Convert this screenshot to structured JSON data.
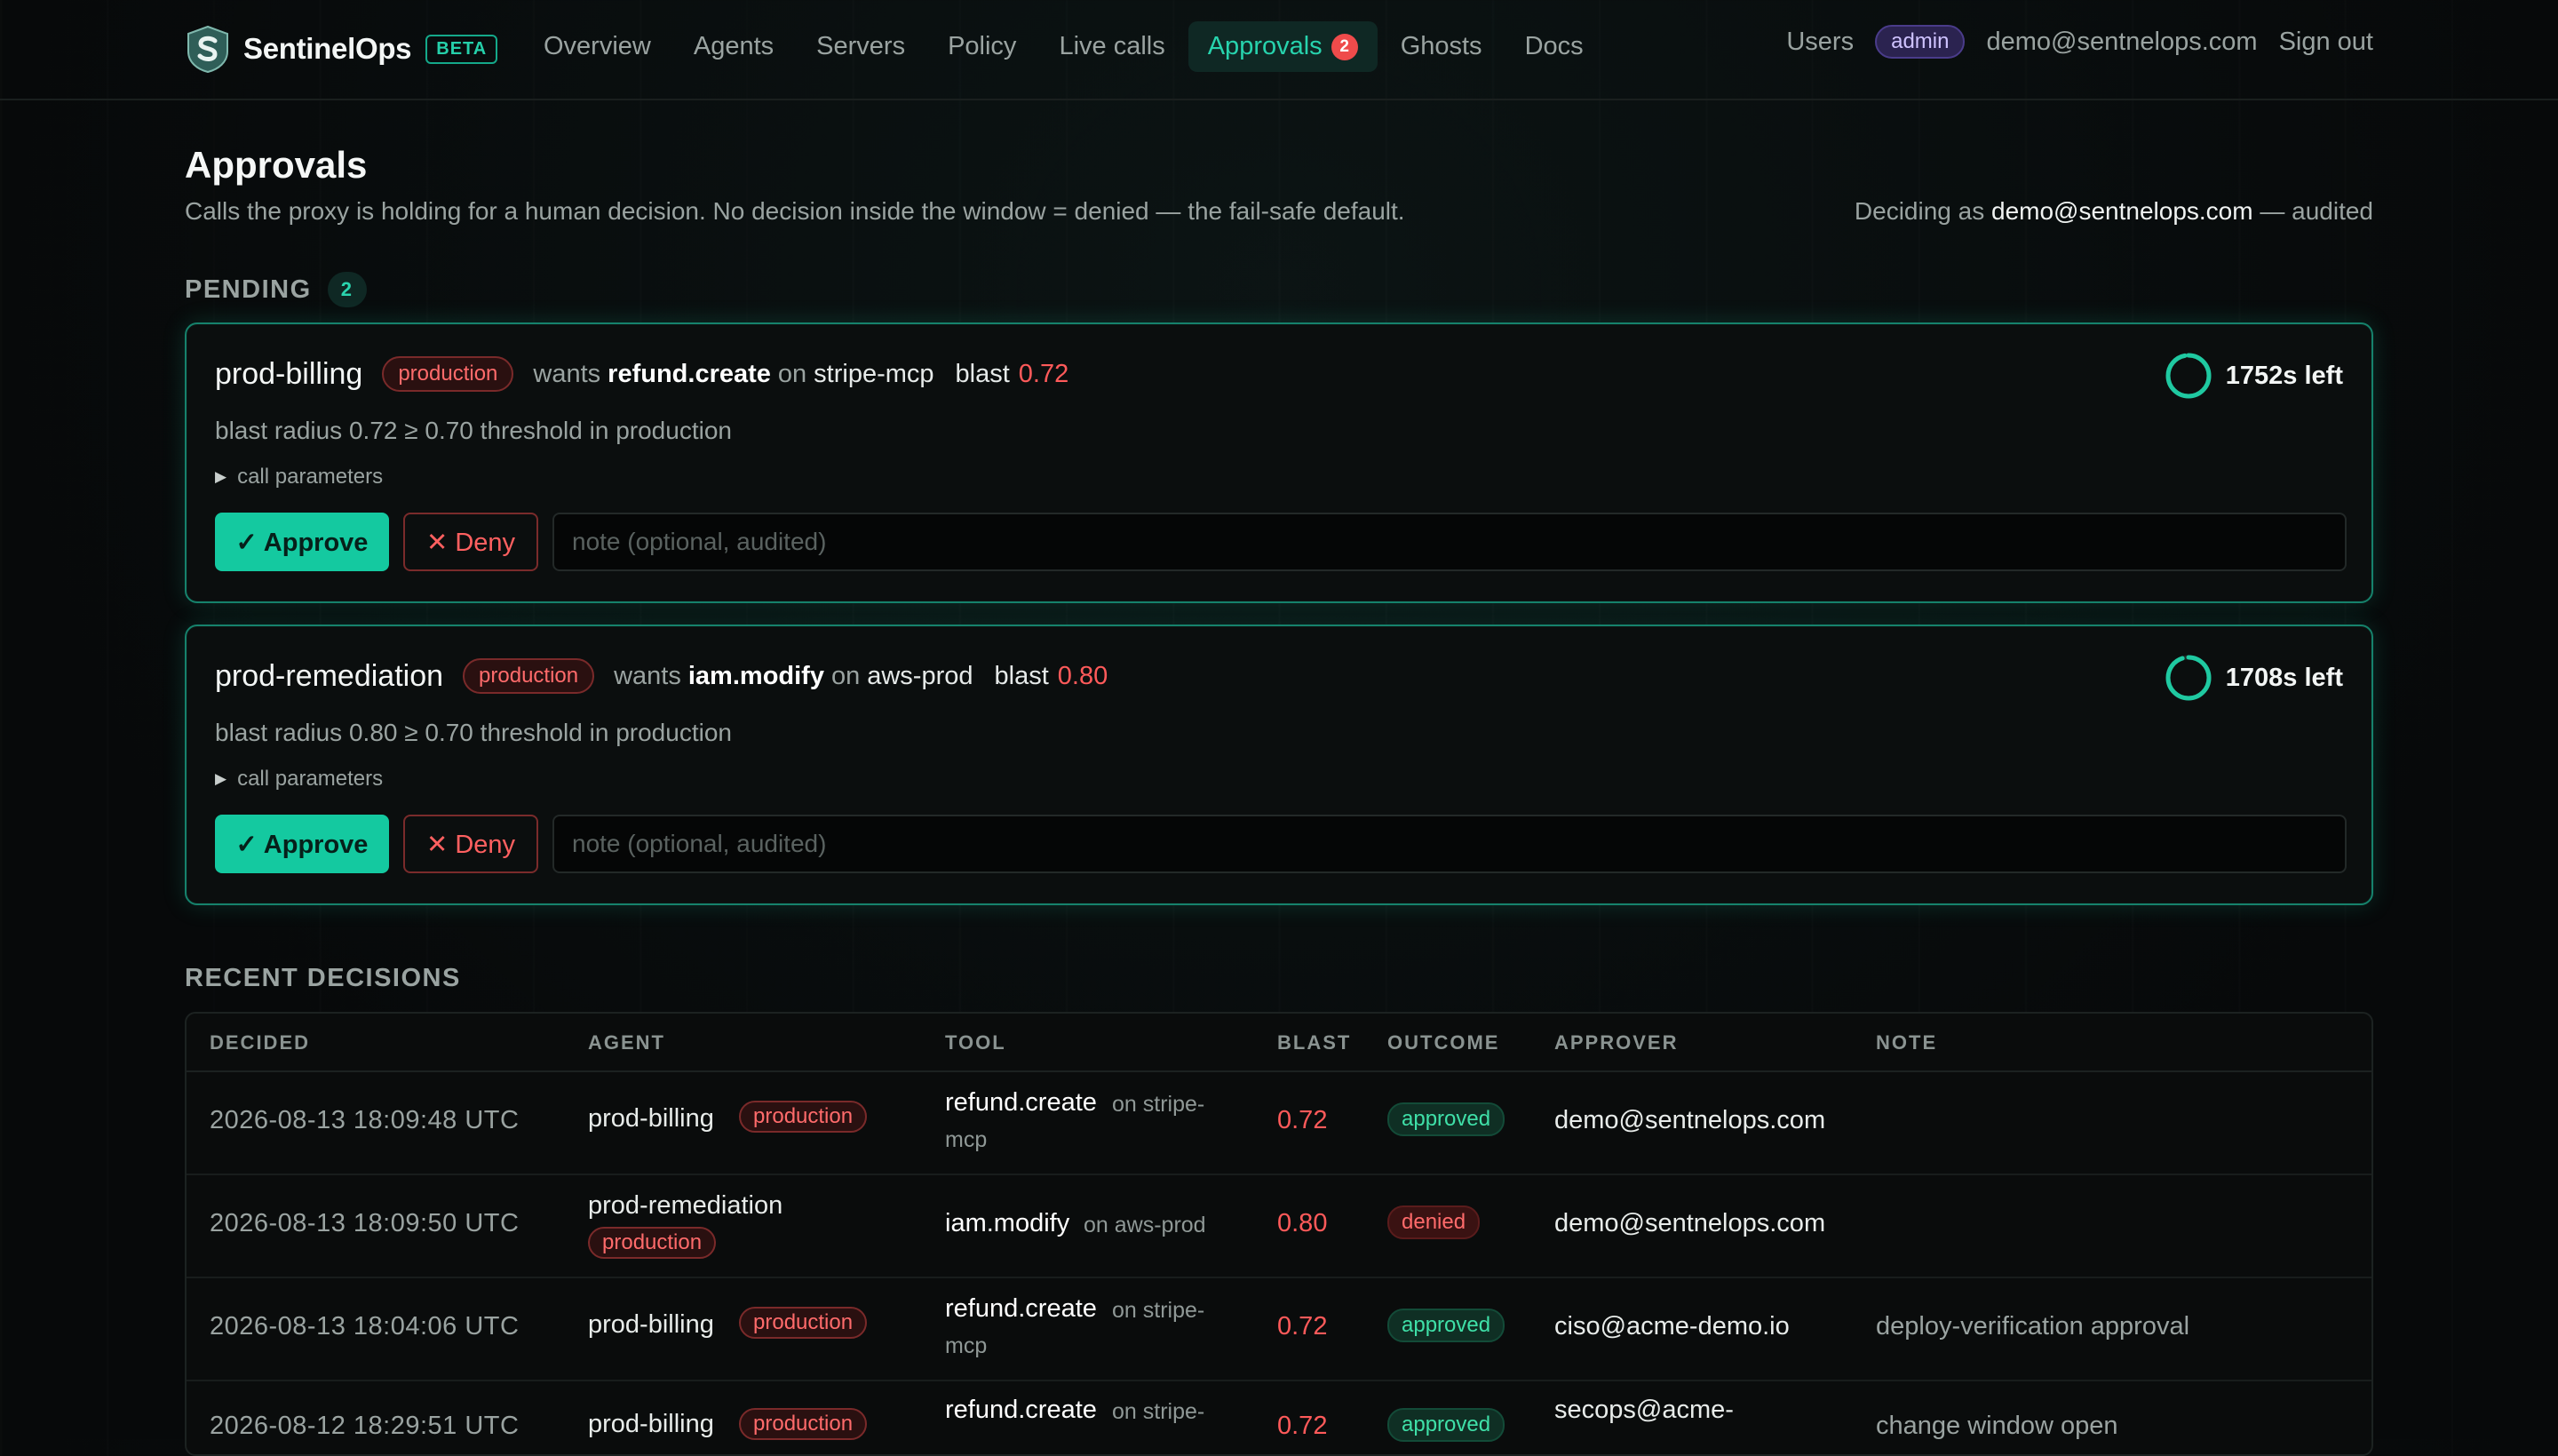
{
  "nav": {
    "brand": "SentinelOps",
    "beta": "BETA",
    "links": [
      "Overview",
      "Agents",
      "Servers",
      "Policy",
      "Live calls",
      "Approvals",
      "Ghosts",
      "Docs"
    ],
    "approvals_count": "2",
    "users": "Users",
    "role": "admin",
    "email": "demo@sentnelops.com",
    "signout": "Sign out"
  },
  "header": {
    "title": "Approvals",
    "subtitle": "Calls the proxy is holding for a human decision. No decision inside the window = denied — the fail-safe default.",
    "deciding_prefix": "Deciding as ",
    "deciding_email": "demo@sentnelops.com",
    "deciding_suffix": " — audited"
  },
  "pending": {
    "label": "PENDING",
    "count": "2",
    "items": [
      {
        "agent": "prod-billing",
        "env": "production",
        "wants": "wants",
        "tool": "refund.create",
        "on": "on",
        "server": "stripe-mcp",
        "blast_label": "blast",
        "blast": "0.72",
        "timer": "1752s left",
        "reason": "blast radius 0.72 ≥ 0.70 threshold in production",
        "params": "call parameters",
        "approve": "✓ Approve",
        "deny": "✕ Deny",
        "note_placeholder": "note (optional, audited)"
      },
      {
        "agent": "prod-remediation",
        "env": "production",
        "wants": "wants",
        "tool": "iam.modify",
        "on": "on",
        "server": "aws-prod",
        "blast_label": "blast",
        "blast": "0.80",
        "timer": "1708s left",
        "reason": "blast radius 0.80 ≥ 0.70 threshold in production",
        "params": "call parameters",
        "approve": "✓ Approve",
        "deny": "✕ Deny",
        "note_placeholder": "note (optional, audited)"
      }
    ]
  },
  "recent": {
    "label": "RECENT DECISIONS",
    "columns": [
      "DECIDED",
      "AGENT",
      "TOOL",
      "BLAST",
      "OUTCOME",
      "APPROVER",
      "NOTE"
    ],
    "rows": [
      {
        "decided": "2026-08-13 18:09:48 UTC",
        "agent": "prod-billing",
        "env": "production",
        "tool": "refund.create",
        "on1": "on stripe-",
        "on2": "mcp",
        "blast": "0.72",
        "outcome": "approved",
        "approver": "demo@sentnelops.com",
        "approver2": "",
        "note": ""
      },
      {
        "decided": "2026-08-13 18:09:50 UTC",
        "agent": "prod-remediation",
        "env": "production",
        "tool": "iam.modify",
        "on1": "on aws-prod",
        "on2": "",
        "blast": "0.80",
        "outcome": "denied",
        "approver": "demo@sentnelops.com",
        "approver2": "",
        "note": ""
      },
      {
        "decided": "2026-08-13 18:04:06 UTC",
        "agent": "prod-billing",
        "env": "production",
        "tool": "refund.create",
        "on1": "on stripe-",
        "on2": "mcp",
        "blast": "0.72",
        "outcome": "approved",
        "approver": "ciso@acme-demo.io",
        "approver2": "",
        "note": "deploy-verification approval"
      },
      {
        "decided": "2026-08-12 18:29:51 UTC",
        "agent": "prod-billing",
        "env": "production",
        "tool": "refund.create",
        "on1": "on stripe-",
        "on2": "",
        "blast": "0.72",
        "outcome": "approved",
        "approver": "secops@acme-",
        "approver2": "",
        "note": "change window open"
      }
    ]
  },
  "colors": {
    "accent": "#14c9a0",
    "danger": "#ff5a5a",
    "background": "#07090a"
  },
  "timer_progress": [
    0.97,
    0.95
  ]
}
